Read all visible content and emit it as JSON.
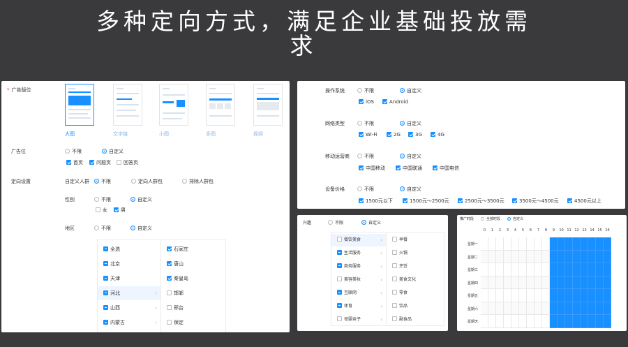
{
  "headline": {
    "line1": "多种定向方式，满足企业基础投放需",
    "line2": "求"
  },
  "left_panel": {
    "ad_slot": {
      "label": "广告版位",
      "required_mark": "*",
      "options": [
        "大图",
        "文字链",
        "小图",
        "多图",
        "视频"
      ]
    },
    "ad_position": {
      "label": "广告位",
      "radio_unlimited": "不限",
      "radio_custom": "自定义",
      "checks": [
        {
          "label": "首页",
          "checked": true
        },
        {
          "label": "问题页",
          "checked": true
        },
        {
          "label": "回答页",
          "checked": false
        }
      ]
    },
    "targeting": {
      "label": "定向设置",
      "custom_crowd": {
        "label": "自定义人群",
        "options": [
          "不限",
          "定向人群包",
          "排除人群包"
        ]
      },
      "gender": {
        "label": "性别",
        "radio_unlimited": "不限",
        "radio_custom": "自定义",
        "checks": [
          {
            "label": "女",
            "checked": false
          },
          {
            "label": "男",
            "checked": true
          }
        ]
      },
      "region": {
        "label": "地区",
        "radio_unlimited": "不限",
        "radio_custom": "自定义",
        "provinces": [
          "全选",
          "北京",
          "天津",
          "河北",
          "山西",
          "内蒙古"
        ],
        "province_arrow": "›",
        "cities": [
          {
            "label": "石家庄",
            "checked": true
          },
          {
            "label": "唐山",
            "checked": true
          },
          {
            "label": "秦皇岛",
            "checked": true
          },
          {
            "label": "邯郸",
            "checked": false
          },
          {
            "label": "邢台",
            "checked": false
          },
          {
            "label": "保定",
            "checked": false
          }
        ]
      }
    }
  },
  "right_panel": {
    "os": {
      "label": "操作系统",
      "radio_unlimited": "不限",
      "radio_custom": "自定义",
      "checks": [
        {
          "label": "iOS",
          "checked": true
        },
        {
          "label": "Android",
          "checked": true
        }
      ]
    },
    "network": {
      "label": "网络类型",
      "radio_unlimited": "不限",
      "radio_custom": "自定义",
      "checks": [
        {
          "label": "Wi-Fi",
          "checked": true
        },
        {
          "label": "2G",
          "checked": true
        },
        {
          "label": "3G",
          "checked": true
        },
        {
          "label": "4G",
          "checked": true
        }
      ]
    },
    "carrier": {
      "label": "移动运营商",
      "radio_unlimited": "不限",
      "radio_custom": "自定义",
      "checks": [
        {
          "label": "中国移动",
          "checked": true
        },
        {
          "label": "中国联通",
          "checked": true
        },
        {
          "label": "中国电信",
          "checked": true
        }
      ]
    },
    "price": {
      "label": "设备价格",
      "radio_unlimited": "不限",
      "radio_custom": "自定义",
      "checks": [
        {
          "label": "1500元以下",
          "checked": true
        },
        {
          "label": "1500元～2500元",
          "checked": true
        },
        {
          "label": "2500元～3500元",
          "checked": true
        },
        {
          "label": "3500元～4500元",
          "checked": true
        },
        {
          "label": "4500元以上",
          "checked": true
        }
      ]
    }
  },
  "interest_panel": {
    "label": "兴趣",
    "radio_unlimited": "不限",
    "radio_custom": "自定义",
    "categories": [
      {
        "label": "餐饮美食",
        "state": "none"
      },
      {
        "label": "生活服务",
        "state": "ind"
      },
      {
        "label": "商务服务",
        "state": "ind"
      },
      {
        "label": "美容美妆",
        "state": "none"
      },
      {
        "label": "互联网",
        "state": "ind"
      },
      {
        "label": "体育",
        "state": "ind"
      },
      {
        "label": "母婴亲子",
        "state": "none"
      }
    ],
    "arrow": "›",
    "subcategories": [
      "早餐",
      "火锅",
      "烹饪",
      "美食文化",
      "零食",
      "饮品",
      "副食品"
    ]
  },
  "schedule_panel": {
    "label": "推广时段",
    "radio_all": "全部时段",
    "radio_custom": "自定义",
    "hours": [
      "0",
      "1",
      "2",
      "3",
      "4",
      "5",
      "6",
      "7",
      "8",
      "9",
      "10",
      "11",
      "12",
      "13",
      "14",
      "15",
      "16"
    ],
    "days": [
      "星期一",
      "星期二",
      "星期三",
      "星期四",
      "星期五",
      "星期六",
      "星期天"
    ],
    "selected_from_hour": 9,
    "accent": "#1890ff"
  }
}
